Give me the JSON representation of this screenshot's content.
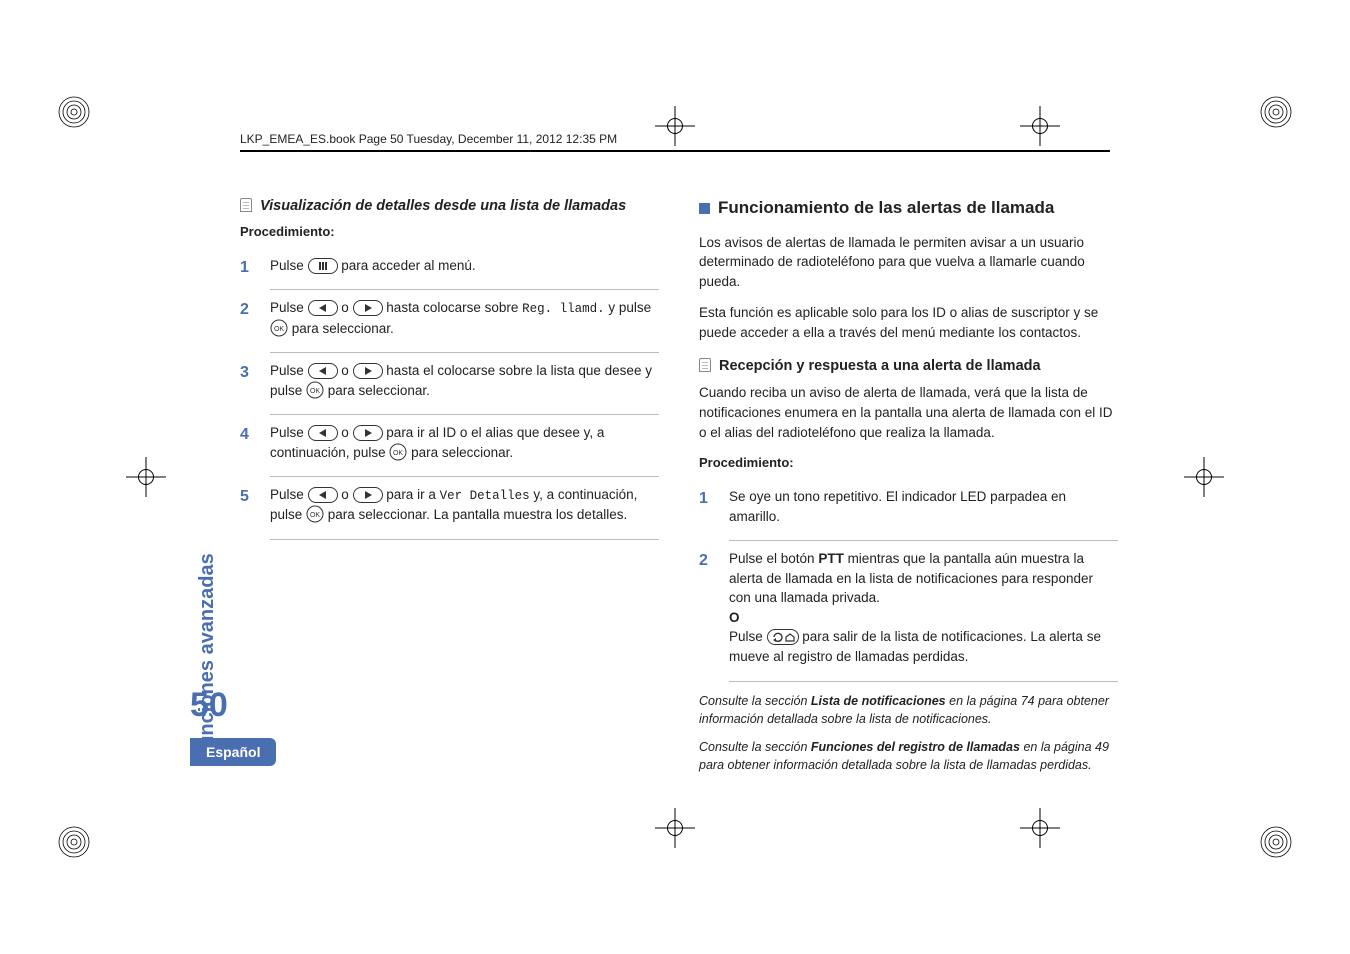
{
  "runhead": "LKP_EMEA_ES.book  Page 50  Tuesday, December 11, 2012  12:35 PM",
  "sidebar_text": "Funciones avanzadas",
  "page_number": "50",
  "lang_pill": "Español",
  "left": {
    "title": "Visualización de detalles desde una lista de llamadas",
    "proc_label": "Procedimiento:",
    "step1": {
      "a": "Pulse ",
      "b": " para acceder al menú."
    },
    "step2": {
      "a": "Pulse ",
      "b": " o ",
      "c": " hasta colocarse sobre ",
      "mono": "Reg. llamd.",
      "d": " y pulse ",
      "e": " para seleccionar."
    },
    "step3": {
      "a": "Pulse  ",
      "b": " o ",
      "c": " hasta el colocarse sobre la lista que desee y pulse ",
      "d": " para seleccionar."
    },
    "step4": {
      "a": "Pulse ",
      "b": " o ",
      "c": " para ir al ID o el alias que desee y, a continuación, pulse ",
      "d": " para seleccionar."
    },
    "step5": {
      "a": "Pulse ",
      "b": " o ",
      "c": " para ir a ",
      "mono": "Ver Detalles",
      "d": " y, a continuación, pulse ",
      "e": " para seleccionar. La pantalla muestra los detalles."
    }
  },
  "right": {
    "main_heading": "Funcionamiento de las alertas de llamada",
    "para1": "Los avisos de alertas de llamada le permiten avisar a un usuario determinado de radioteléfono para que vuelva a llamarle cuando pueda.",
    "para2": "Esta función es aplicable solo para los ID o alias de suscriptor y se puede acceder a ella a través del menú mediante los contactos.",
    "sub_heading": "Recepción y respuesta a una alerta de llamada",
    "para3": "Cuando reciba un aviso de alerta de llamada, verá que la lista de notificaciones enumera en la pantalla una alerta de llamada con el ID o el alias del radioteléfono que realiza la llamada.",
    "proc_label": "Procedimiento:",
    "step1": "Se oye un tono repetitivo. El indicador LED parpadea en amarillo.",
    "step2": {
      "a": "Pulse el botón ",
      "ptt": "PTT",
      "b": " mientras que la pantalla aún muestra la alerta de llamada en la lista de notificaciones para responder con una llamada privada.",
      "or": "O",
      "c": "Pulse ",
      "d": " para salir de la lista de notificaciones. La alerta se mueve al registro de llamadas perdidas."
    },
    "note1": {
      "a": "Consulte la sección ",
      "b": "Lista de notificaciones",
      "c": " en la página 74 para obtener información detallada sobre la lista de notificaciones."
    },
    "note2": {
      "a": "Consulte la sección ",
      "b": "Funciones del registro de llamadas",
      "c": " en la página 49 para obtener información detallada sobre la lista de llamadas perdidas."
    }
  }
}
